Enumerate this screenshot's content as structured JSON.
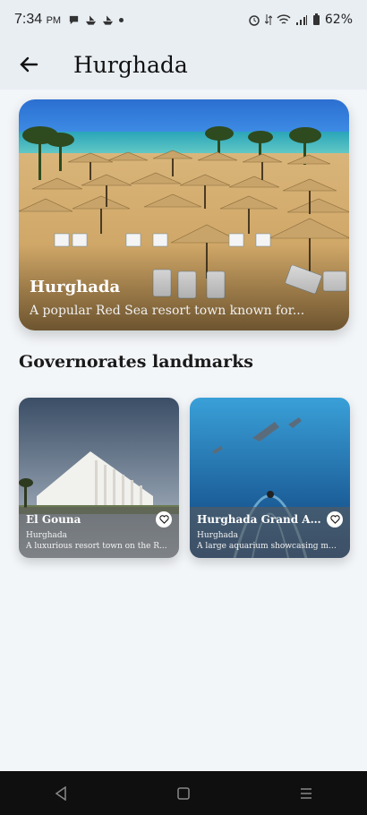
{
  "status_bar": {
    "time": "7:34",
    "ampm": "PM",
    "battery": "62%"
  },
  "app_bar": {
    "title": "Hurghada"
  },
  "hero": {
    "title": "Hurghada",
    "subtitle": "A popular Red Sea resort town known for..."
  },
  "section": {
    "title": "Governorates landmarks"
  },
  "landmarks": [
    {
      "title": "El Gouna",
      "location": "Hurghada",
      "description": "A luxurious resort town on the R..."
    },
    {
      "title": "Hurghada Grand Aq...",
      "location": "Hurghada",
      "description": "A large aquarium showcasing ma..."
    }
  ]
}
